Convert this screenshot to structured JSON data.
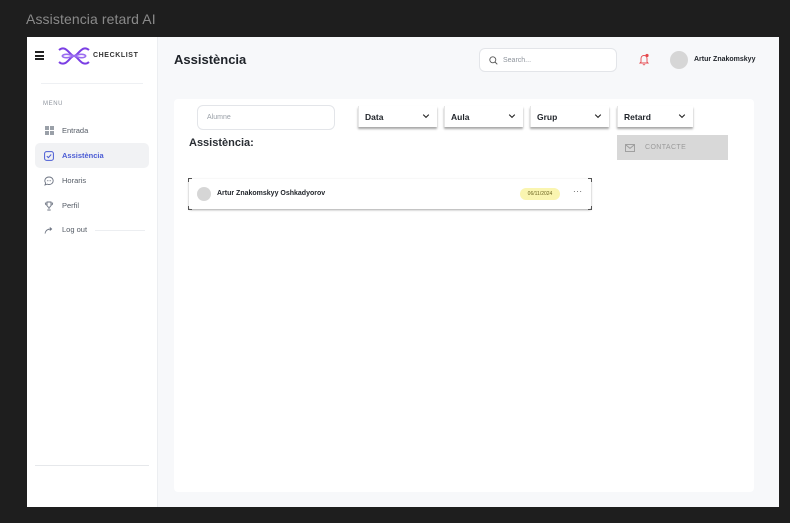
{
  "window": {
    "title": "Assistencia retard AI"
  },
  "sidebar": {
    "logo_text": "CHECKLIST",
    "menu_label": "MENU",
    "items": [
      {
        "label": "Entrada",
        "icon": "grid-icon",
        "active": false
      },
      {
        "label": "Assistència",
        "icon": "check-square-icon",
        "active": true
      },
      {
        "label": "Horaris",
        "icon": "chat-bubble-icon",
        "active": false
      },
      {
        "label": "Perfil",
        "icon": "trophy-icon",
        "active": false
      },
      {
        "label": "Log out",
        "icon": "logout-icon",
        "active": false
      }
    ]
  },
  "header": {
    "title": "Assistència",
    "search_placeholder": "Search...",
    "user_name": "Artur Znakomskyy"
  },
  "filters": {
    "alumne_placeholder": "Alumne",
    "dropdowns": [
      "Data",
      "Aula",
      "Grup",
      "Retard"
    ]
  },
  "main": {
    "section_title": "Assistència:",
    "contact_button": "CONTACTE",
    "records": [
      {
        "name": "Artur Znakomskyy Oshkadyorov",
        "date": "06/11/2024",
        "more": "···"
      }
    ]
  },
  "colors": {
    "accent": "#4a5bd4",
    "logo": "#7b3fe4",
    "badge_bg": "#faf5b0",
    "notification_dot": "#e5484d"
  }
}
